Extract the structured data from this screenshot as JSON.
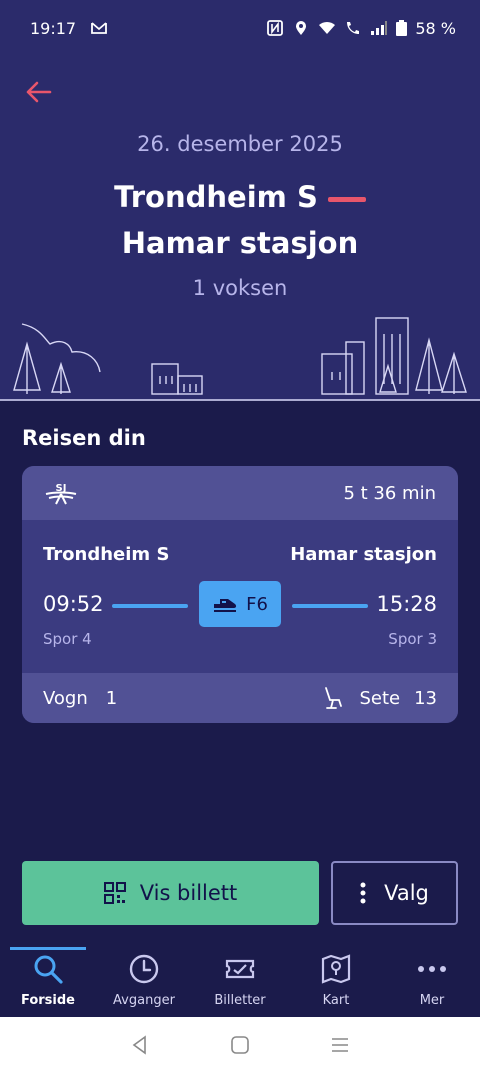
{
  "status_bar": {
    "time": "19:17",
    "battery": "58 %",
    "icons": [
      "gmail-icon",
      "nfc-icon",
      "location-icon",
      "wifi-icon",
      "wifi-call-icon",
      "signal-icon",
      "battery-icon"
    ]
  },
  "header": {
    "date": "26. desember 2025",
    "from": "Trondheim S",
    "to": "Hamar stasjon",
    "passengers": "1 voksen"
  },
  "trip": {
    "section_title": "Reisen din",
    "duration": "5 t 36 min",
    "from_station": "Trondheim S",
    "to_station": "Hamar stasjon",
    "departure_time": "09:52",
    "arrival_time": "15:28",
    "train_line": "F6",
    "departure_track": "Spor 4",
    "arrival_track": "Spor 3",
    "wagon_label": "Vogn",
    "wagon_number": "1",
    "seat_label": "Sete",
    "seat_number": "13"
  },
  "actions": {
    "show_ticket": "Vis billett",
    "options": "Valg"
  },
  "bottom_nav": [
    {
      "label": "Forside",
      "icon": "search-icon",
      "active": true
    },
    {
      "label": "Avganger",
      "icon": "clock-icon",
      "active": false
    },
    {
      "label": "Billetter",
      "icon": "ticket-icon",
      "active": false
    },
    {
      "label": "Kart",
      "icon": "map-icon",
      "active": false
    },
    {
      "label": "Mer",
      "icon": "more-icon",
      "active": false
    }
  ],
  "colors": {
    "background": "#1b1b4b",
    "header": "#2b2b6b",
    "accent_red": "#e8566b",
    "accent_blue": "#4aa4f2",
    "accent_green": "#5cc39a"
  }
}
